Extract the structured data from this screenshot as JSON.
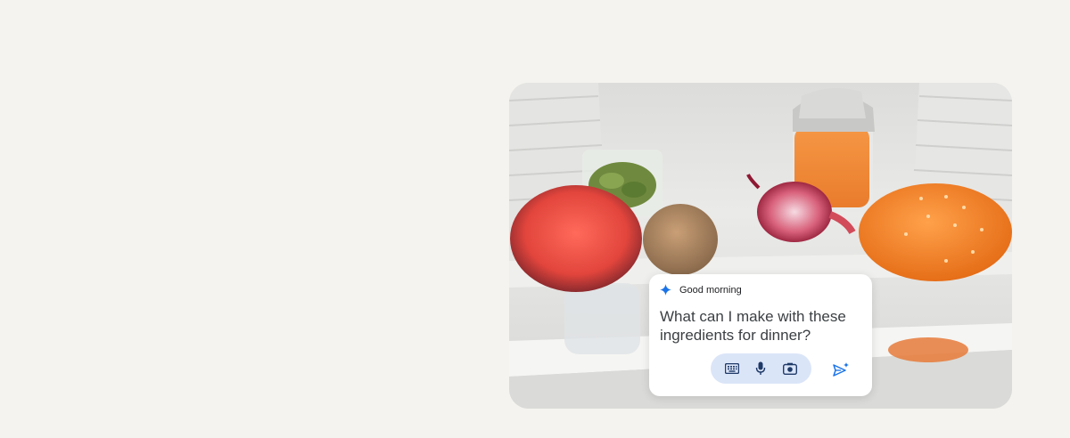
{
  "assistant_card": {
    "greeting": "Good morning",
    "prompt": "What can I make with these ingredients for dinner?",
    "icons": {
      "assistant": "sparkle-icon",
      "keyboard": "keyboard-icon",
      "microphone": "microphone-icon",
      "camera": "camera-icon",
      "send": "send-icon"
    },
    "colors": {
      "accent_blue": "#1a73e8",
      "pill_background": "#dbe5f8",
      "icon_dark": "#1f3a68"
    }
  }
}
